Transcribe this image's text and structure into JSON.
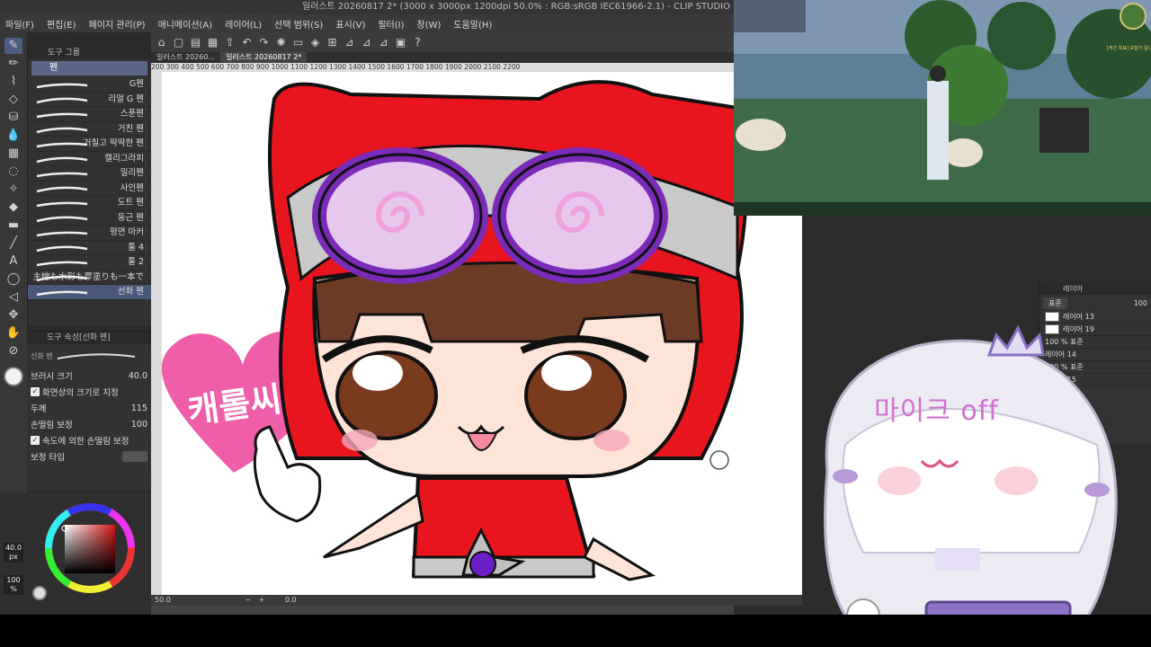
{
  "app": {
    "title": "일러스트 20260817 2* (3000 x 3000px 1200dpi 50.0% : RGB:sRGB IEC61966-2.1) - CLIP STUDIO"
  },
  "menu": [
    "파일(F)",
    "편집(E)",
    "페이지 관리(P)",
    "애니메이션(A)",
    "레이어(L)",
    "선택 범위(S)",
    "표시(V)",
    "필터(I)",
    "창(W)",
    "도움말(H)"
  ],
  "doc_tabs": [
    "일러스트 20260...",
    "일러스트 20260817 2*"
  ],
  "ruler_ticks": "200  300  400  500  600  700  800  900  1000 1100 1200 1300 1400 1500 1600 1700 1800 1900 2000 2100 2200",
  "subtool": {
    "header": "도구 그룹",
    "group": "펜",
    "brushes": [
      "G펜",
      "리얼 G 펜",
      "스푼펜",
      "거친 펜",
      "거칠고 딱딱한 펜",
      "캘리그라피",
      "밀리펜",
      "사인펜",
      "도트 펜",
      "둥근 펜",
      "평면 마커",
      "툴 4",
      "툴 2",
      "主線も水彩も厚塗りも一本で",
      "선화 펜"
    ],
    "selected_index": 14
  },
  "tool_property": {
    "header": "도구 속성[선화 펜]",
    "tool_name": "선화 펜",
    "brush_size_label": "브러시 크기",
    "brush_size_value": "40.0",
    "screen_size_label": "화면상의 크기로 지정",
    "thickness_label": "두께",
    "thickness_value": "115",
    "correction_label": "손떨림 보정",
    "correction_value": "100",
    "speed_correction_label": "속도에 의한 손떨림 보정",
    "correction_type_label": "보정 타입"
  },
  "color": {
    "zoom_value": "40.0",
    "zoom_unit": "px",
    "opacity": "100",
    "opacity_unit": "%"
  },
  "canvas_status": {
    "zoom": "50.0",
    "angle": "0.0"
  },
  "layers": {
    "header": "레이어",
    "blend": "표준",
    "opacity": "100",
    "rows": [
      "레이어 13",
      "레이어 19",
      "100 % 표준",
      "레이어 14",
      "100 % 표준",
      "레이어 15"
    ]
  },
  "artwork": {
    "heart_text": "캐롤씨"
  },
  "overlay": {
    "mic_text": "마이크 off"
  },
  "game": {
    "quest_text": "[주간 목표] 모험가 길드의 참가 의뢰"
  },
  "colors": {
    "accent_blue": "#596687",
    "hood_red": "#e8141e",
    "goggle_purple": "#7a2bb8",
    "heart_pink": "#ef5ea8",
    "mic_text": "#d070d0"
  }
}
